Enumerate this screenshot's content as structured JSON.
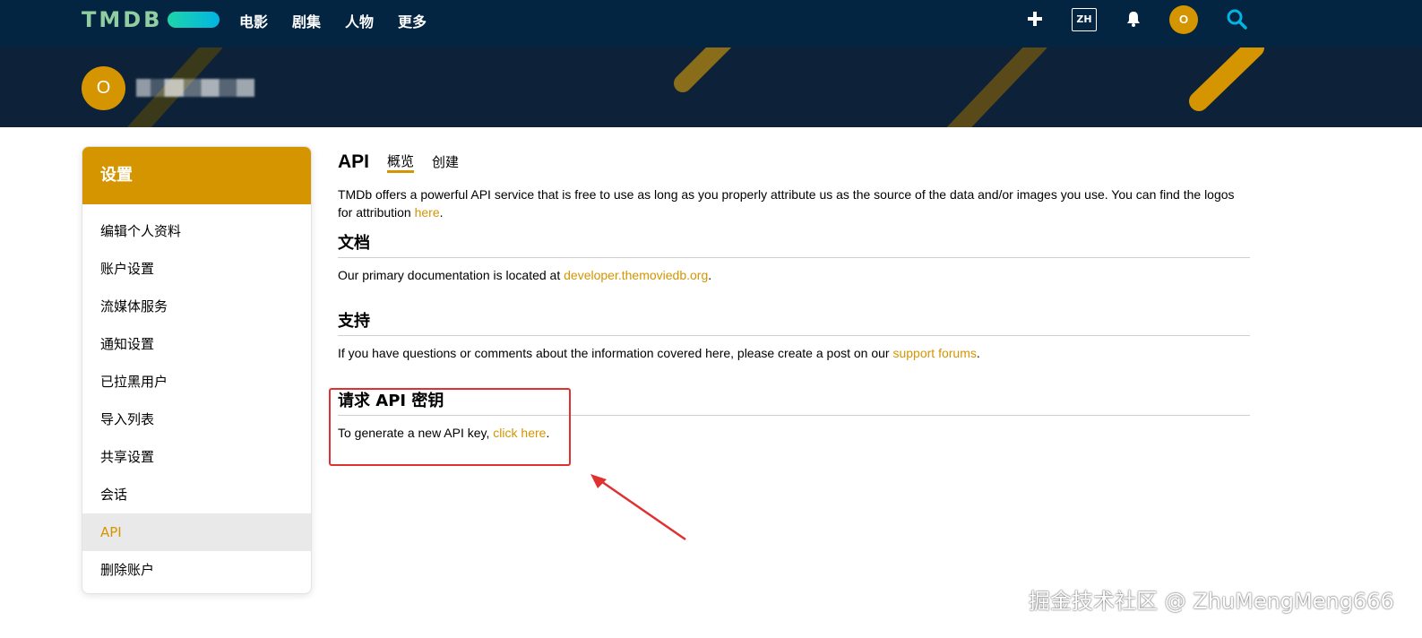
{
  "header": {
    "logo_text": "TMDB",
    "nav": [
      "电影",
      "剧集",
      "人物",
      "更多"
    ],
    "lang": "ZH",
    "avatar_initial": "O",
    "colors": {
      "nav_bg": "#032541",
      "accent": "#d49500",
      "logo_green": "#90cea1",
      "logo_blue": "#01b4e4"
    },
    "icons": [
      "plus-icon",
      "bell-icon",
      "search-icon"
    ]
  },
  "profile": {
    "avatar_initial": "O"
  },
  "sidebar": {
    "title": "设置",
    "items": [
      {
        "label": "编辑个人资料"
      },
      {
        "label": "账户设置"
      },
      {
        "label": "流媒体服务"
      },
      {
        "label": "通知设置"
      },
      {
        "label": "已拉黑用户"
      },
      {
        "label": "导入列表"
      },
      {
        "label": "共享设置"
      },
      {
        "label": "会话"
      },
      {
        "label": "API",
        "active": true
      },
      {
        "label": "删除账户"
      }
    ]
  },
  "main": {
    "title": "API",
    "tabs": [
      {
        "label": "概览",
        "active": true
      },
      {
        "label": "创建"
      }
    ],
    "intro_text": "TMDb offers a powerful API service that is free to use as long as you properly attribute us as the source of the data and/or images you use. You can find the logos for attribution ",
    "intro_link": "here",
    "intro_end": ".",
    "docs": {
      "heading": "文档",
      "text": "Our primary documentation is located at ",
      "link": "developer.themoviedb.org",
      "end": "."
    },
    "support": {
      "heading": "支持",
      "text": "If you have questions or comments about the information covered here, please create a post on our ",
      "link": "support forums",
      "end": "."
    },
    "request": {
      "heading": "请求 API 密钥",
      "text": "To generate a new API key, ",
      "link": "click here",
      "end": "."
    }
  },
  "watermark": "掘金技术社区 @ ZhuMengMeng666"
}
